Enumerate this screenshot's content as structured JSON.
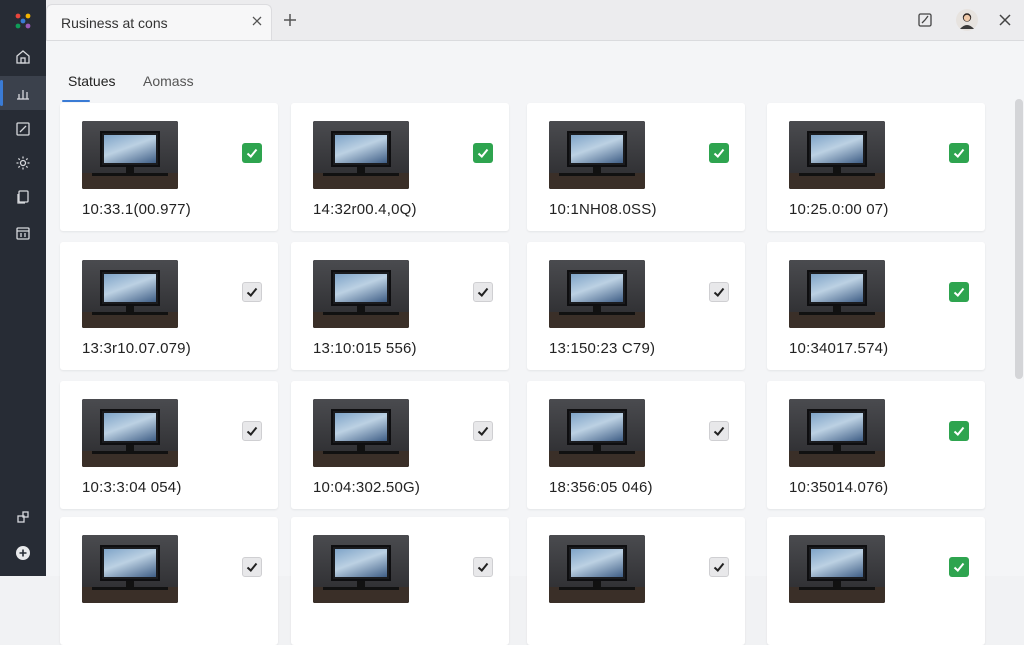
{
  "topbar": {
    "tab_title": "Rusiness at cons",
    "close_icon": "close-icon",
    "new_tab_icon": "plus-icon",
    "right_icons": [
      "edit-note-icon",
      "avatar",
      "close-icon"
    ]
  },
  "sidebar": {
    "logo": "app-logo",
    "items": [
      {
        "icon": "home-icon",
        "active": false
      },
      {
        "icon": "chart-icon",
        "active": true
      },
      {
        "icon": "edit-icon",
        "active": false
      },
      {
        "icon": "settings-icon",
        "active": false
      },
      {
        "icon": "document-icon",
        "active": false
      },
      {
        "icon": "calendar-icon",
        "active": false
      }
    ],
    "bottom_items": [
      {
        "icon": "puzzle-icon"
      },
      {
        "icon": "add-icon"
      }
    ]
  },
  "subtabs": [
    {
      "label": "Statues",
      "active": true
    },
    {
      "label": "Aomass",
      "active": false
    }
  ],
  "colors": {
    "accent": "#3a7bd5",
    "check_green": "#2ea44f",
    "sidebar_bg": "#272c35"
  },
  "cards": [
    {
      "time": "10:33.1(00.977)",
      "checked": true
    },
    {
      "time": "14:32r00.4,0Q)",
      "checked": true
    },
    {
      "time": "10:1NH08.0SS)",
      "checked": true
    },
    {
      "time": "10:25.0:00 07)",
      "checked": true
    },
    {
      "time": "13:3r10.07.079)",
      "checked": false
    },
    {
      "time": "13:10:015 556)",
      "checked": false
    },
    {
      "time": "13:150:23 C79)",
      "checked": false
    },
    {
      "time": "10:34017.574)",
      "checked": true
    },
    {
      "time": "10:3:3:04 054)",
      "checked": false
    },
    {
      "time": "10:04:302.50G)",
      "checked": false
    },
    {
      "time": "18:356:05 046)",
      "checked": false
    },
    {
      "time": "10:35014.076)",
      "checked": true
    },
    {
      "time": "",
      "checked": false
    },
    {
      "time": "",
      "checked": false
    },
    {
      "time": "",
      "checked": false
    },
    {
      "time": "",
      "checked": true
    }
  ]
}
